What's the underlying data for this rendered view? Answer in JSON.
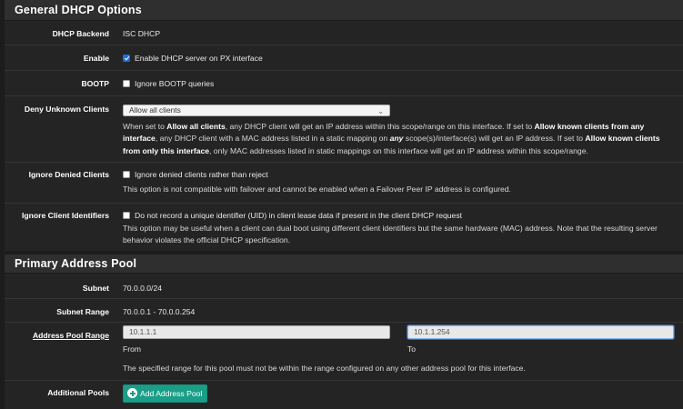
{
  "general": {
    "heading": "General DHCP Options",
    "backend": {
      "label": "DHCP Backend",
      "value": "ISC DHCP"
    },
    "enable": {
      "label": "Enable",
      "checkbox_text": "Enable DHCP server on PX interface",
      "checked": true
    },
    "bootp": {
      "label": "BOOTP",
      "checkbox_text": "Ignore BOOTP queries",
      "checked": false
    },
    "deny_unknown": {
      "label": "Deny Unknown Clients",
      "selected": "Allow all clients",
      "help": {
        "t1": "When set to ",
        "b1": "Allow all clients",
        "t2": ", any DHCP client will get an IP address within this scope/range on this interface. If set to ",
        "b2": "Allow known clients from any interface",
        "t3": ", any DHCP client with a MAC address listed in a static mapping on ",
        "b3": "any",
        "t4": " scope(s)/interface(s) will get an IP address. If set to ",
        "b4": "Allow known clients from only this interface",
        "t5": ", only MAC addresses listed in static mappings on this interface will get an IP address within this scope/range."
      }
    },
    "ignore_denied": {
      "label": "Ignore Denied Clients",
      "checkbox_text": "Ignore denied clients rather than reject",
      "checked": false,
      "help": "This option is not compatible with failover and cannot be enabled when a Failover Peer IP address is configured."
    },
    "ignore_ids": {
      "label": "Ignore Client Identifiers",
      "checkbox_text": "Do not record a unique identifier (UID) in client lease data if present in the client DHCP request",
      "checked": false,
      "help": "This option may be useful when a client can dual boot using different client identifiers but the same hardware (MAC) address. Note that the resulting server behavior violates the official DHCP specification."
    }
  },
  "pool": {
    "heading": "Primary Address Pool",
    "subnet": {
      "label": "Subnet",
      "value": "70.0.0.0/24"
    },
    "subnet_range": {
      "label": "Subnet Range",
      "value": "70.0.0.1 - 70.0.0.254"
    },
    "address_range": {
      "label": "Address Pool Range",
      "from_value": "10.1.1.1",
      "from_label": "From",
      "to_value": "10.1.1.254",
      "to_label": "To",
      "help": "The specified range for this pool must not be within the range configured on any other address pool for this interface."
    },
    "additional": {
      "label": "Additional Pools",
      "button": "Add Address Pool"
    }
  },
  "colors": {
    "accent_button": "#1b9e88",
    "checkbox_checked": "#1d6fd6",
    "panel_bg": "#242424",
    "page_bg": "#1c1c1c"
  }
}
